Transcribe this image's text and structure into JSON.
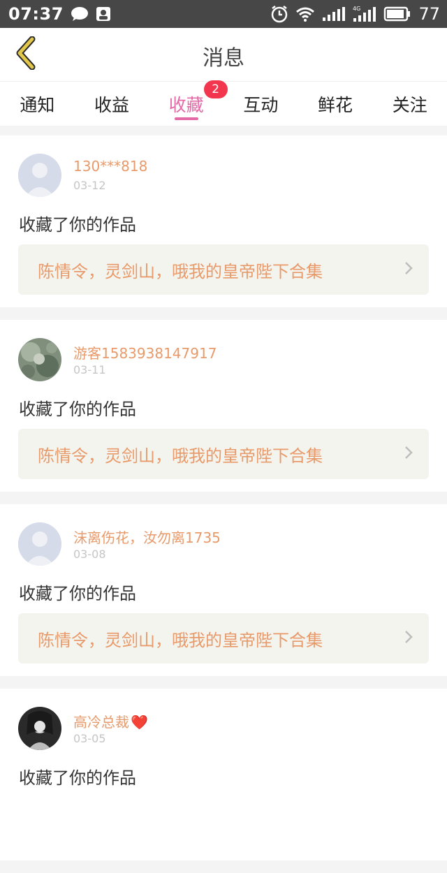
{
  "status_bar": {
    "time": "07:37",
    "battery": "77",
    "icons": [
      "chat-bubble-icon",
      "notification-icon",
      "alarm-icon",
      "wifi-icon",
      "signal-icon",
      "signal-4g-icon",
      "battery-icon"
    ]
  },
  "header": {
    "title": "消息",
    "back_icon": "chevron-left-icon"
  },
  "tabs": [
    {
      "label": "通知"
    },
    {
      "label": "收益"
    },
    {
      "label": "收藏",
      "badge": "2",
      "active": true
    },
    {
      "label": "互动"
    },
    {
      "label": "鲜花"
    },
    {
      "label": "关注"
    }
  ],
  "messages": [
    {
      "user": "130***818",
      "date": "03-12",
      "action": "收藏了你的作品",
      "work": "陈情令，灵剑山，哦我的皇帝陛下合集"
    },
    {
      "user": "游客1583938147917",
      "date": "03-11",
      "action": "收藏了你的作品",
      "work": "陈情令，灵剑山，哦我的皇帝陛下合集"
    },
    {
      "user": "沫离伤花，汝勿离1735",
      "date": "03-08",
      "action": "收藏了你的作品",
      "work": "陈情令，灵剑山，哦我的皇帝陛下合集"
    },
    {
      "user": "高冷总裁",
      "user_suffix": "❤️",
      "date": "03-05",
      "action": "收藏了你的作品"
    }
  ],
  "colors": {
    "accent": "#e36aa6",
    "username": "#e89a6a",
    "badge": "#f2364d",
    "back_chevron": "#e2c74a"
  }
}
